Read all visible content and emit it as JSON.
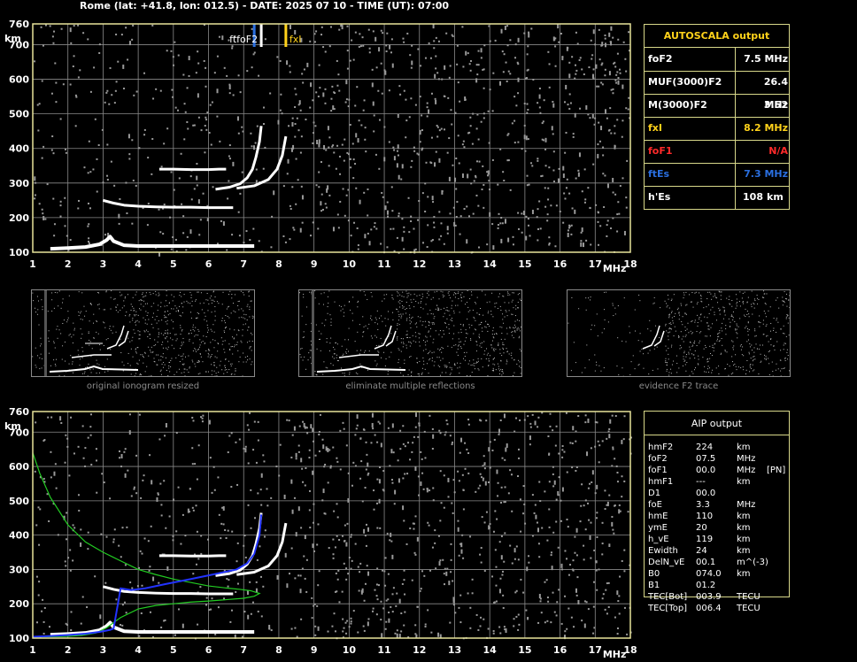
{
  "header": {
    "title": "Rome (lat: +41.8, lon: 012.5) - DATE: 2025 07 10 - TIME (UT): 07:00"
  },
  "colors": {
    "grid": "#8a8a8a",
    "frame": "#e8e49a",
    "trace": "#ffffff",
    "noise": "#9a9a9a",
    "foF2": "#ffffff",
    "ftEs": "#2a6fe0",
    "fxI": "#ffd21a",
    "foF1": "#ff2a2a",
    "profile": "#22cc22",
    "fit": "#2233ff",
    "panel_border": "#d8d88a"
  },
  "chart_data": [
    {
      "type": "scatter",
      "chart_role": "main ionogram",
      "xlabel": "MHz",
      "ylabel": "km",
      "xlim": [
        1,
        18
      ],
      "ylim": [
        100,
        760
      ],
      "xticks": [
        "1",
        "2",
        "3",
        "4",
        "5",
        "6",
        "7",
        "8",
        "9",
        "10",
        "11",
        "12",
        "13",
        "14",
        "15",
        "16",
        "17",
        "18"
      ],
      "yticks": [
        "100",
        "200",
        "300",
        "400",
        "500",
        "600",
        "700",
        "760"
      ],
      "grid": true,
      "markers": [
        {
          "label": "ftfoF2",
          "x": 7.5,
          "color": "foF2"
        },
        {
          "label": "ftEs",
          "x": 7.3,
          "color": "ftEs"
        },
        {
          "label": "fxI",
          "x": 8.2,
          "color": "fxI"
        }
      ],
      "traces": [
        {
          "name": "E/Es",
          "x": [
            1.5,
            2.0,
            2.5,
            2.9,
            3.1,
            3.2,
            3.3,
            3.6,
            4.0,
            5.0,
            6.0,
            7.0,
            7.3
          ],
          "y": [
            110,
            112,
            115,
            123,
            135,
            145,
            132,
            120,
            118,
            118,
            118,
            118,
            118
          ]
        },
        {
          "name": "F1 (second hop)",
          "x": [
            3.0,
            3.3,
            3.6,
            4.0,
            4.5,
            5.0,
            5.5,
            6.0,
            6.5,
            6.7
          ],
          "y": [
            250,
            242,
            236,
            233,
            231,
            230,
            230,
            229,
            229,
            229
          ]
        },
        {
          "name": "F2 ordinary",
          "x": [
            6.2,
            6.6,
            6.9,
            7.1,
            7.25,
            7.35,
            7.45,
            7.5
          ],
          "y": [
            282,
            288,
            298,
            315,
            340,
            375,
            420,
            465
          ]
        },
        {
          "name": "F2 extraordinary",
          "x": [
            6.8,
            7.3,
            7.7,
            7.95,
            8.1,
            8.2
          ],
          "y": [
            285,
            292,
            310,
            340,
            380,
            435
          ]
        },
        {
          "name": "F multiple",
          "x": [
            4.6,
            5.0,
            5.5,
            6.0,
            6.3,
            6.5
          ],
          "y": [
            340,
            340,
            339,
            339,
            340,
            340
          ]
        }
      ]
    },
    {
      "type": "scatter",
      "chart_role": "interpreted ionogram",
      "xlabel": "MHz",
      "ylabel": "km",
      "xlim": [
        1,
        18
      ],
      "ylim": [
        100,
        760
      ],
      "xticks": [
        "1",
        "2",
        "3",
        "4",
        "5",
        "6",
        "7",
        "8",
        "9",
        "10",
        "11",
        "12",
        "13",
        "14",
        "15",
        "16",
        "17",
        "18"
      ],
      "yticks": [
        "100",
        "200",
        "300",
        "400",
        "500",
        "600",
        "700",
        "760"
      ],
      "grid": true,
      "profile": {
        "x": [
          1.0,
          1.2,
          1.5,
          2.0,
          2.5,
          3.0,
          3.5,
          4.0,
          4.5,
          5.0,
          5.5,
          6.0,
          6.5,
          6.9,
          7.2,
          7.45,
          7.3,
          7.0,
          6.5,
          6.0,
          5.5,
          5.0,
          4.5,
          4.0,
          3.5,
          3.3,
          3.1,
          2.8,
          2.4,
          2.0,
          1.5,
          1.0
        ],
        "y": [
          640,
          580,
          510,
          430,
          380,
          350,
          325,
          300,
          285,
          272,
          262,
          252,
          246,
          242,
          238,
          230,
          222,
          216,
          212,
          208,
          205,
          200,
          195,
          185,
          160,
          145,
          130,
          115,
          108,
          105,
          104,
          103
        ]
      },
      "fit": {
        "x": [
          1.0,
          1.5,
          2.0,
          2.5,
          2.9,
          3.1,
          3.2,
          3.3,
          3.5,
          3.8,
          4.2,
          4.8,
          5.5,
          6.2,
          6.8,
          7.1,
          7.3,
          7.45,
          7.5
        ],
        "y": [
          104,
          106,
          109,
          113,
          118,
          122,
          124,
          128,
          245,
          240,
          245,
          258,
          272,
          287,
          300,
          318,
          345,
          400,
          460
        ]
      }
    }
  ],
  "thumbnails": [
    {
      "caption": "original ionogram resized"
    },
    {
      "caption": "eliminate multiple reflections"
    },
    {
      "caption": "evidence F2 trace"
    }
  ],
  "autoscala": {
    "title": "AUTOSCALA output",
    "rows": [
      {
        "label": "foF2",
        "value": "7.5 MHz",
        "color": "#ffffff"
      },
      {
        "label": "MUF(3000)F2",
        "value": "26.4 MHz",
        "color": "#ffffff"
      },
      {
        "label": "M(3000)F2",
        "value": "3.52",
        "color": "#ffffff"
      },
      {
        "label": "fxI",
        "value": "8.2 MHz",
        "color": "#ffd21a"
      },
      {
        "label": "foF1",
        "value": "N/A",
        "color": "#ff2a2a"
      },
      {
        "label": "ftEs",
        "value": "7.3 MHz",
        "color": "#2a6fe0"
      },
      {
        "label": "h'Es",
        "value": "108",
        "unit": "km",
        "color": "#ffffff"
      }
    ]
  },
  "aip": {
    "title": "AIP output",
    "rows": [
      {
        "label": "hmF2",
        "value": "224",
        "unit": "km",
        "extra": ""
      },
      {
        "label": "foF2",
        "value": "07.5",
        "unit": "MHz",
        "extra": ""
      },
      {
        "label": "foF1",
        "value": "00.0",
        "unit": "MHz",
        "extra": "[PN]"
      },
      {
        "label": "hmF1",
        "value": "---",
        "unit": "km",
        "extra": ""
      },
      {
        "label": "D1",
        "value": "00.0",
        "unit": "",
        "extra": ""
      },
      {
        "label": "foE",
        "value": "3.3",
        "unit": "MHz",
        "extra": ""
      },
      {
        "label": "hmE",
        "value": "110",
        "unit": "km",
        "extra": ""
      },
      {
        "label": "ymE",
        "value": "20",
        "unit": "km",
        "extra": ""
      },
      {
        "label": "h_vE",
        "value": "119",
        "unit": "km",
        "extra": ""
      },
      {
        "label": "Ewidth",
        "value": "24",
        "unit": "km",
        "extra": ""
      },
      {
        "label": "DelN_vE",
        "value": "00.1",
        "unit": "m^(-3)",
        "extra": ""
      },
      {
        "label": "B0",
        "value": "074.0",
        "unit": "km",
        "extra": ""
      },
      {
        "label": "B1",
        "value": "01.2",
        "unit": "",
        "extra": ""
      },
      {
        "label": "TEC[Bot]",
        "value": "003.9",
        "unit": "TECU",
        "extra": ""
      },
      {
        "label": "TEC[Top]",
        "value": "006.4",
        "unit": "TECU",
        "extra": ""
      }
    ]
  }
}
